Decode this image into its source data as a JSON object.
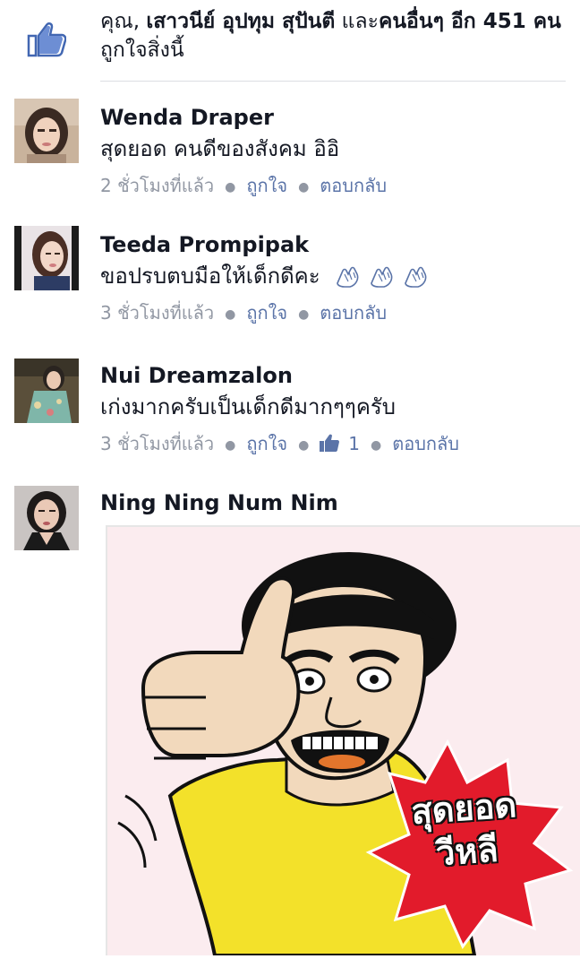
{
  "likes": {
    "prefix": "คุณ, ",
    "names": "เสาวนีย์ อุปทุม สุปันตี",
    "connector": " และ",
    "others": "คนอื่นๆ อีก 451 คน",
    "suffix": "ถูกใจสิ่งนี้"
  },
  "actions": {
    "like": "ถูกใจ",
    "reply": "ตอบกลับ"
  },
  "comments": [
    {
      "name": "Wenda Draper",
      "text": "สุดยอด คนดีของสังคม อิอิ",
      "time": "2 ชั่วโมงที่แล้ว"
    },
    {
      "name": "Teeda Prompipak",
      "text": "ขอปรบตบมือให้เด็กดีคะ",
      "time": "3 ชั่วโมงที่แล้ว"
    },
    {
      "name": "Nui Dreamzalon",
      "text": "เก่งมากครับเป็นเด็กดีมากๆๆครับ",
      "time": "3 ชั่วโมงที่แล้ว",
      "like_count": "1"
    },
    {
      "name": "Ning Ning Num Nim",
      "sticker_text_line1": "สุดยอด",
      "sticker_text_line2": "วีหลี"
    }
  ],
  "colors": {
    "link": "#5b74a8",
    "meta": "#9197a3",
    "like_blue": "#4267b2",
    "shirt": "#f3e12a",
    "burst": "#e21b2b"
  }
}
